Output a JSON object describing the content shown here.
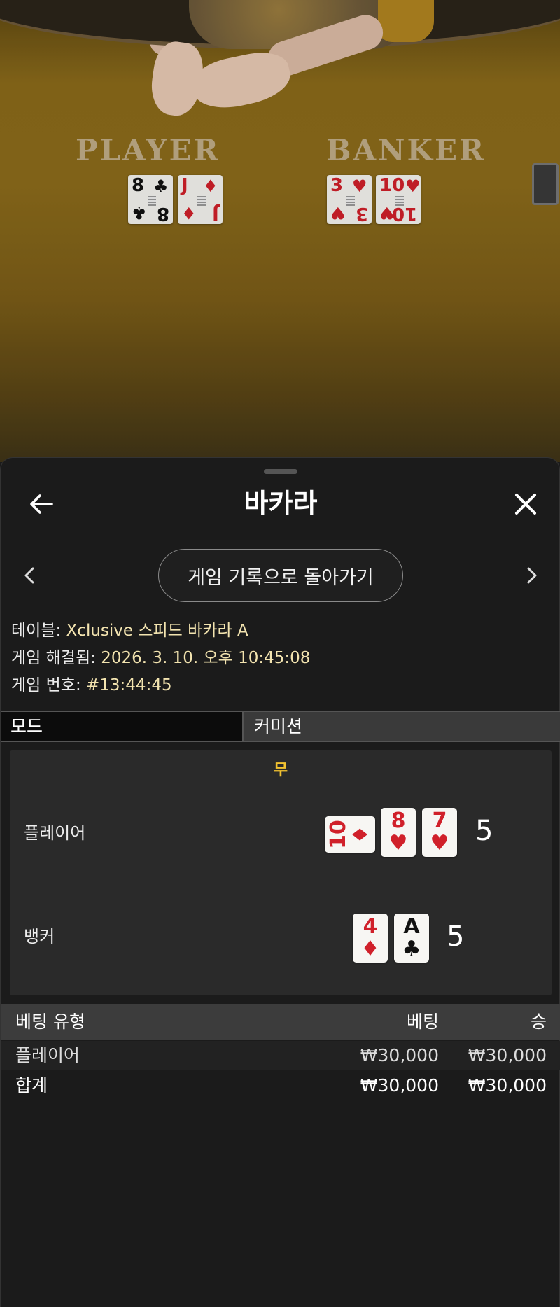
{
  "video": {
    "player_label": "PLAYER",
    "banker_label": "BANKER",
    "player_cards": [
      {
        "rank": "8",
        "suit": "♣",
        "color": "black"
      },
      {
        "rank": "J",
        "suit": "♦",
        "color": "red"
      }
    ],
    "banker_cards": [
      {
        "rank": "3",
        "suit": "♥",
        "color": "red"
      },
      {
        "rank": "10",
        "suit": "♥",
        "color": "red"
      }
    ]
  },
  "sheet": {
    "title": "바카라",
    "back_icon": "arrow-left-icon",
    "close_icon": "close-icon",
    "back_to_history": "게임 기록으로 돌아가기",
    "info": {
      "table_label": "테이블:",
      "table_value": "Xclusive 스피드 바카라 A",
      "resolved_label": "게임 해결됨:",
      "resolved_value": "2026. 3. 10. 오후 10:45:08",
      "game_no_label": "게임 번호:",
      "game_no_value": "#13:44:45"
    },
    "mode": {
      "label": "모드",
      "value": "커미션"
    },
    "result": {
      "outcome": "무",
      "player_label": "플레이어",
      "player_score": "5",
      "player_cards": [
        {
          "rank": "10",
          "suit": "♦",
          "color": "red",
          "orientation": "sideways"
        },
        {
          "rank": "8",
          "suit": "♥",
          "color": "red"
        },
        {
          "rank": "7",
          "suit": "♥",
          "color": "red"
        }
      ],
      "banker_label": "뱅커",
      "banker_score": "5",
      "banker_cards": [
        {
          "rank": "4",
          "suit": "♦",
          "color": "red"
        },
        {
          "rank": "A",
          "suit": "♣",
          "color": "black"
        }
      ]
    },
    "bets": {
      "headers": {
        "type": "베팅 유형",
        "bet": "베팅",
        "win": "승"
      },
      "rows": [
        {
          "type": "플레이어",
          "bet": "₩30,000",
          "win": "₩30,000"
        }
      ],
      "total": {
        "type": "합계",
        "bet": "₩30,000",
        "win": "₩30,000"
      }
    }
  },
  "colors": {
    "outcome": "#f2c230",
    "info_value": "#f3e4b0",
    "card_red": "#d0202a",
    "background": "#1b1b1b"
  }
}
